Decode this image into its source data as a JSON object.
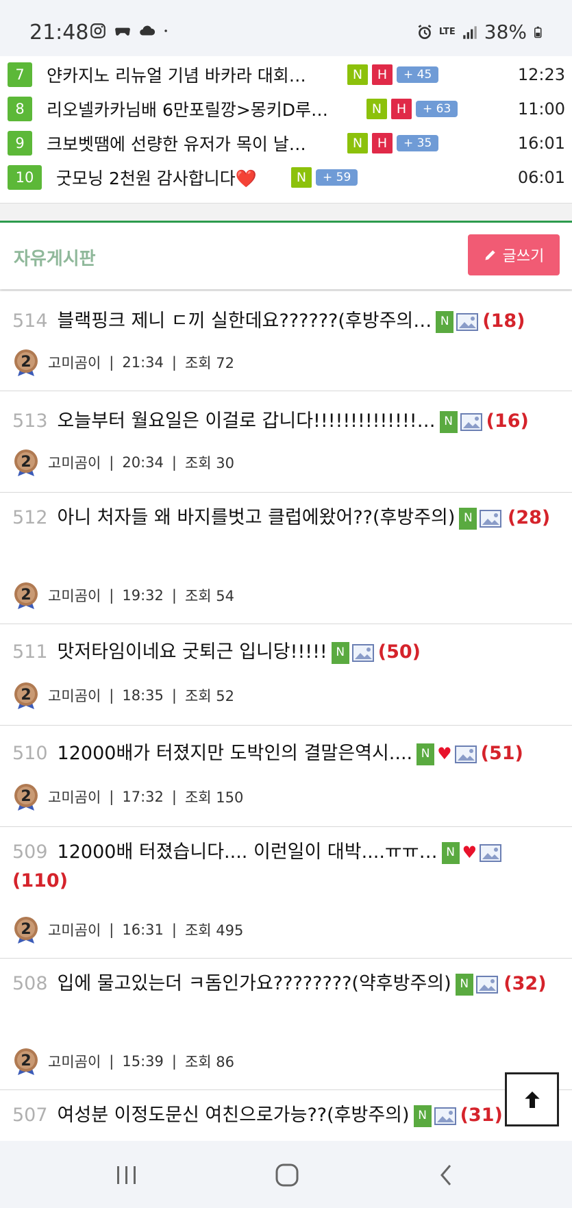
{
  "status": {
    "time": "21:48",
    "network": "LTE",
    "battery": "38%"
  },
  "ranking": [
    {
      "rank": "7",
      "title": "얀카지노 리뉴얼 기념 바카라 대회…",
      "badges": [
        "N",
        "H"
      ],
      "count": "+ 45",
      "time": "12:23"
    },
    {
      "rank": "8",
      "title": "리오넬카카님배 6만포릴깡>몽키D루…",
      "badges": [
        "N",
        "H"
      ],
      "count": "+ 63",
      "time": "11:00"
    },
    {
      "rank": "9",
      "title": "크보벳땜에 선량한 유저가 목이 날…",
      "badges": [
        "N",
        "H"
      ],
      "count": "+ 35",
      "time": "16:01"
    },
    {
      "rank": "10",
      "title": "굿모닝 2천원 감사합니다❤️",
      "badges": [
        "N"
      ],
      "count": "+ 59",
      "time": "06:01"
    }
  ],
  "board": {
    "title": "자유게시판",
    "write_label": "글쓰기"
  },
  "posts": [
    {
      "num": "514",
      "title": "블랙핑크 제니 ㄷ끼 실한데요??????(후방주의…",
      "badge": "N",
      "heart": false,
      "comments": "(18)",
      "author": "고미곰이",
      "time": "21:34",
      "views": "조회 72"
    },
    {
      "num": "513",
      "title": "오늘부터 월요일은 이걸로 갑니다!!!!!!!!!!!!!!…",
      "badge": "N",
      "heart": false,
      "comments": "(16)",
      "author": "고미곰이",
      "time": "20:34",
      "views": "조회 30"
    },
    {
      "num": "512",
      "title": "아니 처자들 왜 바지를벗고 클럽에왔어??(후방주의)",
      "badge": "N",
      "heart": false,
      "comments": "(28)",
      "author": "고미곰이",
      "time": "19:32",
      "views": "조회 54"
    },
    {
      "num": "511",
      "title": "맛저타임이네요 굿퇴근 입니당!!!!!",
      "badge": "N",
      "heart": false,
      "comments": "(50)",
      "author": "고미곰이",
      "time": "18:35",
      "views": "조회 52"
    },
    {
      "num": "510",
      "title": "12000배가 터졌지만 도박인의 결말은역시....",
      "badge": "N",
      "heart": true,
      "comments": "(51)",
      "author": "고미곰이",
      "time": "17:32",
      "views": "조회 150"
    },
    {
      "num": "509",
      "title": "12000배 터졌습니다.... 이런일이 대박....ㅠㅠ…",
      "badge": "N",
      "heart": true,
      "comments": "(110)",
      "author": "고미곰이",
      "time": "16:31",
      "views": "조회 495"
    },
    {
      "num": "508",
      "title": "입에 물고있는더 ㅋ돔인가요????????(약후방주의)",
      "badge": "N",
      "heart": false,
      "comments": "(32)",
      "author": "고미곰이",
      "time": "15:39",
      "views": "조회 86"
    },
    {
      "num": "507",
      "title": "여성분 이정도문신 여친으로가능??(후방주의)",
      "badge": "N",
      "heart": false,
      "comments": "(31)",
      "author": "",
      "time": "",
      "views": ""
    }
  ],
  "colors": {
    "accent_green": "#2d9b4d",
    "write_button": "#f15b74",
    "comment_red": "#d5232b"
  }
}
